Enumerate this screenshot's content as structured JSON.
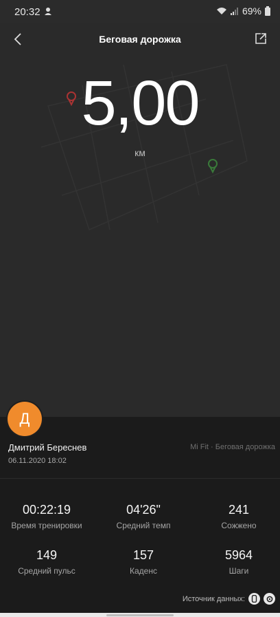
{
  "status_bar": {
    "time": "20:32",
    "battery": "69%"
  },
  "header": {
    "title": "Беговая дорожка"
  },
  "workout": {
    "distance": "5,00",
    "unit": "км"
  },
  "user": {
    "initial": "Д",
    "name": "Дмитрий Береснев",
    "date": "06.11.2020 18:02",
    "source": "Mi Fit · Беговая дорожка"
  },
  "stats": [
    {
      "value": "00:22:19",
      "label": "Время тренировки"
    },
    {
      "value": "04'26\"",
      "label": "Средний темп"
    },
    {
      "value": "241",
      "label": "Сожжено"
    },
    {
      "value": "149",
      "label": "Средний пульс"
    },
    {
      "value": "157",
      "label": "Каденс"
    },
    {
      "value": "5964",
      "label": "Шаги"
    }
  ],
  "footer": {
    "data_source_label": "Источник данных:"
  },
  "colors": {
    "accent": "#f08b2c",
    "background": "#2a2a2a",
    "panel": "#1b1b1b"
  }
}
